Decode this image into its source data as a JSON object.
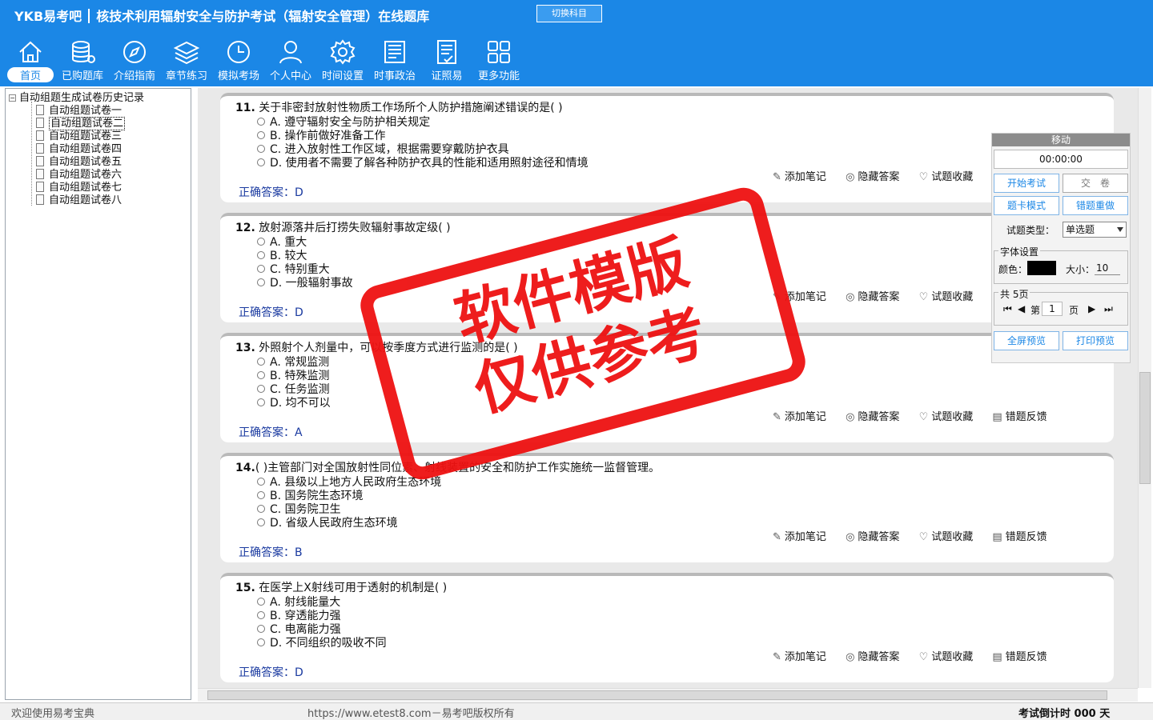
{
  "header": {
    "brand": "YKB易考吧",
    "title": "核技术利用辐射安全与防护考试（辐射安全管理）在线题库",
    "switch_label": "切换科目"
  },
  "nav": [
    {
      "label": "首页",
      "icon": "home-icon"
    },
    {
      "label": "已购题库",
      "icon": "database-icon"
    },
    {
      "label": "介绍指南",
      "icon": "compass-icon"
    },
    {
      "label": "章节练习",
      "icon": "layers-icon"
    },
    {
      "label": "模拟考场",
      "icon": "clock-icon"
    },
    {
      "label": "个人中心",
      "icon": "user-icon"
    },
    {
      "label": "时间设置",
      "icon": "gear-icon"
    },
    {
      "label": "时事政治",
      "icon": "news-icon"
    },
    {
      "label": "证照易",
      "icon": "certificate-icon"
    },
    {
      "label": "更多功能",
      "icon": "grid-icon"
    }
  ],
  "tree": {
    "root": "自动组题生成试卷历史记录",
    "items": [
      "自动组题试卷一",
      "自动组题试卷二",
      "自动组题试卷三",
      "自动组题试卷四",
      "自动组题试卷五",
      "自动组题试卷六",
      "自动组题试卷七",
      "自动组题试卷八"
    ],
    "selected": "自动组题试卷二"
  },
  "questions": [
    {
      "num": "11.",
      "text": "关于非密封放射性物质工作场所个人防护措施阐述错误的是( )",
      "options": [
        "A. 遵守辐射安全与防护相关规定",
        "B. 操作前做好准备工作",
        "C. 进入放射性工作区域，根据需要穿戴防护衣具",
        "D. 使用者不需要了解各种防护衣具的性能和适用照射途径和情境"
      ],
      "answer_label": "正确答案：",
      "answer": "D"
    },
    {
      "num": "12.",
      "text": "放射源落井后打捞失败辐射事故定级( )",
      "options": [
        "A. 重大",
        "B. 较大",
        "C. 特别重大",
        "D. 一般辐射事故"
      ],
      "answer_label": "正确答案：",
      "answer": "D"
    },
    {
      "num": "13.",
      "text": "外照射个人剂量中，可以按季度方式进行监测的是( )",
      "options": [
        "A. 常规监测",
        "B. 特殊监测",
        "C. 任务监测",
        "D. 均不可以"
      ],
      "answer_label": "正确答案：",
      "answer": "A"
    },
    {
      "num": "14.",
      "text": "( )主管部门对全国放射性同位素、射线装置的安全和防护工作实施统一监督管理。",
      "options": [
        "A. 县级以上地方人民政府生态环境",
        "B. 国务院生态环境",
        "C. 国务院卫生",
        "D. 省级人民政府生态环境"
      ],
      "answer_label": "正确答案：",
      "answer": "B"
    },
    {
      "num": "15.",
      "text": "在医学上X射线可用于透射的机制是( )",
      "options": [
        "A. 射线能量大",
        "B. 穿透能力强",
        "C. 电离能力强",
        "D. 不同组织的吸收不同"
      ],
      "answer_label": "正确答案：",
      "answer": "D"
    }
  ],
  "actions": {
    "note": "添加笔记",
    "hide": "隐藏答案",
    "fav": "试题收藏",
    "feedback": "错题反馈"
  },
  "panel": {
    "move": "移动",
    "timer": "00:00:00",
    "start": "开始考试",
    "submit": "交　卷",
    "card_mode": "题卡模式",
    "redo": "错题重做",
    "type_label": "试题类型：",
    "type_value": "单选题",
    "font_label": "字体设置",
    "color_label": "颜色：",
    "size_label": "大小：",
    "size_value": "10",
    "total_pages": "共 5页",
    "page_prefix": "第",
    "page_value": "1",
    "page_suffix": "页",
    "fullscreen": "全屏预览",
    "print": "打印预览"
  },
  "watermark": {
    "line1": "软件模版",
    "line2": "仅供参考"
  },
  "status": {
    "welcome": "欢迎使用易考宝典",
    "copyright": "https://www.etest8.com－易考吧版权所有",
    "countdown": "考试倒计时 000 天"
  }
}
